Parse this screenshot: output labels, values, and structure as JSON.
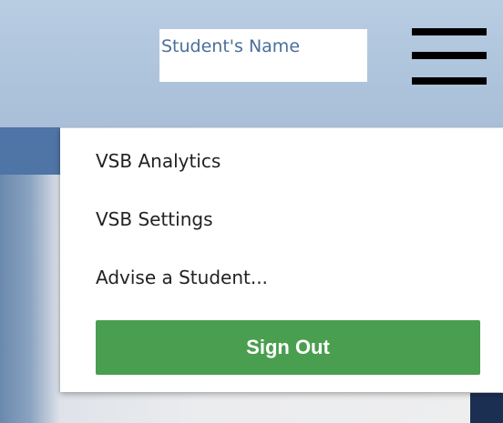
{
  "header": {
    "student_name_placeholder": "Student's Name",
    "menu_icon": "hamburger-menu-icon"
  },
  "menu": {
    "items": [
      {
        "label": "VSB Analytics"
      },
      {
        "label": "VSB Settings"
      },
      {
        "label": "Advise a Student..."
      }
    ],
    "signout_label": "Sign Out"
  },
  "colors": {
    "header_bg": "#adc4dc",
    "name_text": "#4a6f9c",
    "signout_bg": "#4a9e4f",
    "accent_blue": "#4f74a6",
    "corner_dark": "#1b2f52"
  }
}
